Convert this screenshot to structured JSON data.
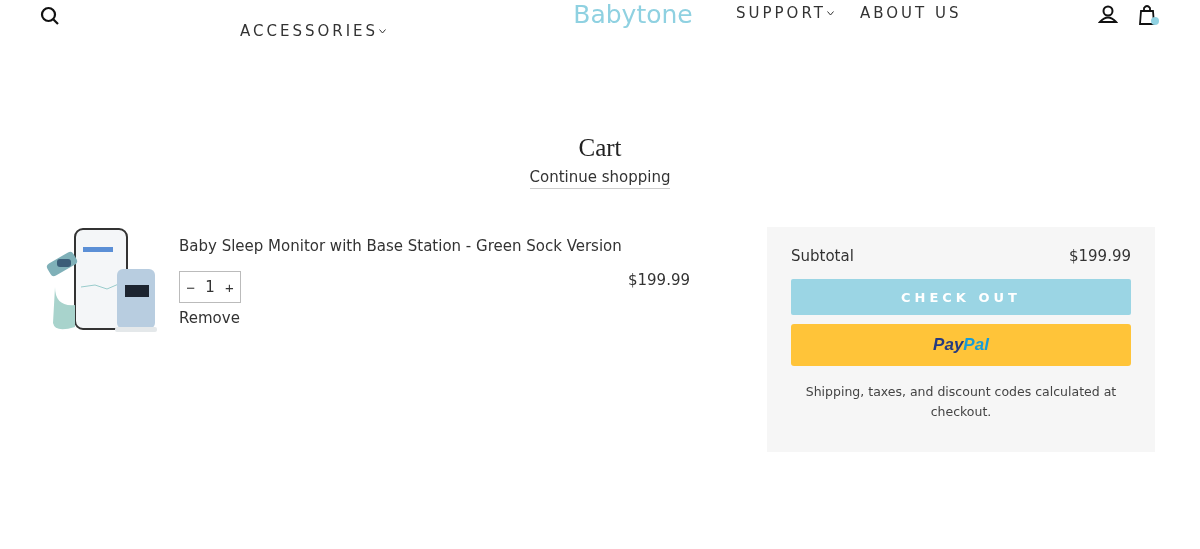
{
  "header": {
    "left_nav": [
      {
        "label": "ACCESSORIES",
        "has_dropdown": true
      }
    ],
    "logo": "Babytone",
    "right_nav": [
      {
        "label": "SUPPORT",
        "has_dropdown": true
      },
      {
        "label": "ABOUT US",
        "has_dropdown": false
      }
    ]
  },
  "cart": {
    "title": "Cart",
    "continue_link": "Continue shopping",
    "items": [
      {
        "name": "Baby Sleep Monitor with Base Station - Green Sock Version",
        "quantity": {
          "decrease": "−",
          "value": "1",
          "increase": "+"
        },
        "remove": "Remove",
        "price": "$199.99"
      }
    ]
  },
  "summary": {
    "subtotal_label": "Subtotal",
    "subtotal_value": "$199.99",
    "checkout_button": "CHECK OUT",
    "paypal_button": {
      "part_1": "Pay",
      "part_2": "Pal"
    },
    "note": "Shipping, taxes, and discount codes calculated at checkout."
  }
}
